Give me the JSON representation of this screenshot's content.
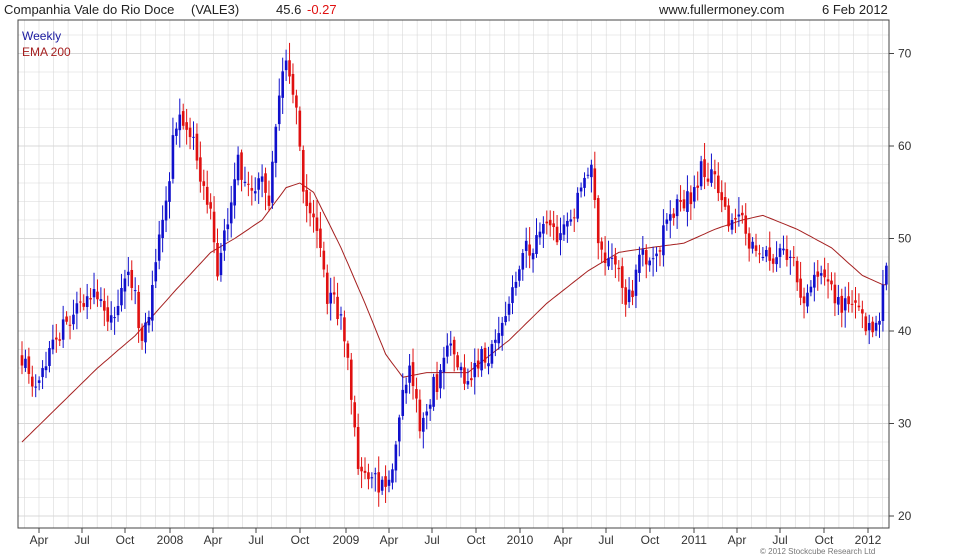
{
  "header": {
    "company": "Companhia Vale do Rio Doce",
    "ticker": "(VALE3)",
    "price": "45.6",
    "change": "-0.27",
    "site": "www.fullermoney.com",
    "date": "6 Feb 2012"
  },
  "footer": {
    "copyright": "© 2012 Stockcube Research Ltd"
  },
  "colors": {
    "up": "#1010cc",
    "down": "#e01010",
    "ema": "#a52020",
    "grid": "#d8d8d8",
    "change": "#e01010"
  },
  "chart_data": {
    "type": "candlestick",
    "frequency": "weekly",
    "x_range": [
      "2007-03",
      "2012-02"
    ],
    "ylim": [
      19,
      73
    ],
    "yticks": [
      20,
      30,
      40,
      50,
      60,
      70
    ],
    "xticks": [
      "Apr",
      "Jul",
      "Oct",
      "2008",
      "Apr",
      "Jul",
      "Oct",
      "2009",
      "Apr",
      "Jul",
      "Oct",
      "2010",
      "Apr",
      "Jul",
      "Oct",
      "2011",
      "Apr",
      "Jul",
      "Oct",
      "2012"
    ],
    "legend": [
      {
        "label": "Weekly",
        "color": "#1a1aa0"
      },
      {
        "label": "EMA 200",
        "color": "#a52020"
      }
    ],
    "close_path": [
      [
        0,
        37
      ],
      [
        3,
        34
      ],
      [
        8,
        38
      ],
      [
        13,
        41
      ],
      [
        17,
        43
      ],
      [
        22,
        44
      ],
      [
        25,
        42
      ],
      [
        27,
        42
      ],
      [
        31,
        47
      ],
      [
        33,
        44
      ],
      [
        35,
        38
      ],
      [
        38,
        44
      ],
      [
        40,
        50
      ],
      [
        43,
        56
      ],
      [
        44,
        62
      ],
      [
        46,
        63
      ],
      [
        48,
        61
      ],
      [
        50,
        60
      ],
      [
        52,
        56
      ],
      [
        55,
        54
      ],
      [
        57,
        46
      ],
      [
        60,
        52
      ],
      [
        63,
        58
      ],
      [
        66,
        56
      ],
      [
        68,
        55
      ],
      [
        70,
        56
      ],
      [
        72,
        53
      ],
      [
        74,
        63
      ],
      [
        76,
        67
      ],
      [
        77,
        70
      ],
      [
        79,
        65
      ],
      [
        80,
        64
      ],
      [
        82,
        54
      ],
      [
        84,
        53
      ],
      [
        86,
        50
      ],
      [
        88,
        47
      ],
      [
        89,
        44
      ],
      [
        91,
        43
      ],
      [
        93,
        41
      ],
      [
        95,
        37
      ],
      [
        97,
        30
      ],
      [
        98,
        26
      ],
      [
        100,
        24
      ],
      [
        102,
        25
      ],
      [
        104,
        23
      ],
      [
        106,
        24
      ],
      [
        107,
        24
      ],
      [
        109,
        28
      ],
      [
        111,
        33
      ],
      [
        113,
        37
      ],
      [
        114,
        34
      ],
      [
        116,
        30
      ],
      [
        118,
        31
      ],
      [
        120,
        34
      ],
      [
        122,
        35
      ],
      [
        124,
        38
      ],
      [
        126,
        38
      ],
      [
        128,
        36
      ],
      [
        130,
        34
      ],
      [
        132,
        36
      ],
      [
        134,
        37
      ],
      [
        136,
        37
      ],
      [
        138,
        39
      ],
      [
        140,
        41
      ],
      [
        143,
        45
      ],
      [
        145,
        47
      ],
      [
        147,
        49
      ],
      [
        149,
        49
      ],
      [
        151,
        50
      ],
      [
        153,
        52
      ],
      [
        155,
        51
      ],
      [
        157,
        50
      ],
      [
        159,
        51
      ],
      [
        161,
        53
      ],
      [
        163,
        55
      ],
      [
        165,
        56
      ],
      [
        166,
        57
      ],
      [
        168,
        50
      ],
      [
        170,
        48
      ],
      [
        172,
        47
      ],
      [
        174,
        46
      ],
      [
        176,
        43
      ],
      [
        178,
        44
      ],
      [
        181,
        49
      ],
      [
        183,
        47
      ],
      [
        185,
        48
      ],
      [
        187,
        51
      ],
      [
        190,
        53
      ],
      [
        193,
        54
      ],
      [
        196,
        55
      ],
      [
        198,
        58
      ],
      [
        200,
        57
      ],
      [
        202,
        56
      ],
      [
        204,
        54
      ],
      [
        206,
        52
      ],
      [
        208,
        51
      ],
      [
        210,
        52
      ],
      [
        212,
        50
      ],
      [
        214,
        49
      ],
      [
        216,
        48
      ],
      [
        219,
        47
      ],
      [
        222,
        49
      ],
      [
        224,
        48
      ],
      [
        226,
        46
      ],
      [
        228,
        43
      ],
      [
        230,
        45
      ],
      [
        233,
        47
      ],
      [
        235,
        45
      ],
      [
        237,
        44
      ],
      [
        239,
        43
      ],
      [
        241,
        42
      ],
      [
        243,
        44
      ],
      [
        245,
        41
      ],
      [
        247,
        40
      ],
      [
        250,
        42
      ],
      [
        252,
        46
      ]
    ],
    "ema_path": [
      [
        0,
        28
      ],
      [
        11,
        32
      ],
      [
        22,
        36
      ],
      [
        33,
        39.5
      ],
      [
        45,
        44.5
      ],
      [
        55,
        48.5
      ],
      [
        62,
        50
      ],
      [
        70,
        52
      ],
      [
        77,
        55.5
      ],
      [
        81,
        56
      ],
      [
        85,
        55
      ],
      [
        93,
        49
      ],
      [
        100,
        43
      ],
      [
        106,
        37.5
      ],
      [
        111,
        35
      ],
      [
        118,
        35.5
      ],
      [
        130,
        35.5
      ],
      [
        142,
        39
      ],
      [
        153,
        43
      ],
      [
        165,
        46.5
      ],
      [
        174,
        48.5
      ],
      [
        183,
        49
      ],
      [
        193,
        49.5
      ],
      [
        202,
        51
      ],
      [
        210,
        52
      ],
      [
        216,
        52.5
      ],
      [
        226,
        51
      ],
      [
        236,
        49
      ],
      [
        245,
        46
      ],
      [
        251,
        45
      ]
    ],
    "weeks": 253,
    "last_close": 45.6,
    "last_change": -0.27
  }
}
